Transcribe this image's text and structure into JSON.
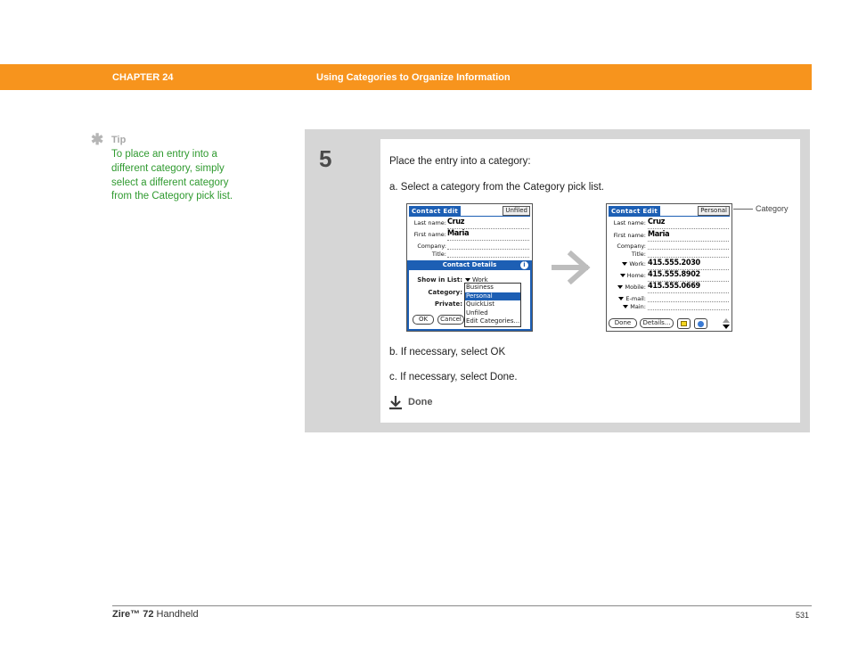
{
  "header": {
    "chapter": "CHAPTER 24",
    "title": "Using Categories to Organize Information"
  },
  "tip": {
    "label": "Tip",
    "text": "To place an entry into a different category, simply select a different category from the Category pick list."
  },
  "step": {
    "number": "5",
    "intro": "Place the entry into a category:",
    "sub_a": "a.  Select a category from the Category pick list.",
    "sub_b": "b.  If necessary, select OK",
    "sub_c": "c.  If necessary, select Done.",
    "done_label": "Done"
  },
  "screen_before": {
    "title": "Contact Edit",
    "category": "Unfiled",
    "last_name_label": "Last name:",
    "last_name": "Cruz",
    "first_name_label": "First name:",
    "first_name": "Maria",
    "company_label": "Company:",
    "title_label": "Title:",
    "dialog": {
      "title": "Contact Details",
      "show_in_list_label": "Show in List:",
      "show_in_list_value": "Work",
      "category_label": "Category:",
      "private_label": "Private:",
      "ok_button": "OK",
      "cancel_button": "Cancel",
      "menu_items": [
        "Business",
        "Personal",
        "QuickList",
        "Unfiled",
        "Edit Categories..."
      ],
      "selected_index": 1
    }
  },
  "screen_after": {
    "title": "Contact Edit",
    "category": "Personal",
    "last_name_label": "Last name:",
    "last_name": "Cruz",
    "first_name_label": "First name:",
    "first_name": "Maria",
    "company_label": "Company:",
    "title_label": "Title:",
    "work_label": "Work:",
    "work_value": "415.555.2030",
    "home_label": "Home:",
    "home_value": "415.555.8902",
    "mobile_label": "Mobile:",
    "mobile_value": "415.555.0669",
    "email_label": "E-mail:",
    "main_label": "Main:",
    "done_button": "Done",
    "details_button": "Details..."
  },
  "callout": {
    "label": "Category"
  },
  "footer": {
    "product_bold": "Zire™ 72",
    "product_rest": " Handheld",
    "page_number": "531"
  },
  "colors": {
    "header_orange": "#f7941d",
    "tip_green": "#2f9a2f",
    "palm_blue": "#1d5fb4"
  }
}
